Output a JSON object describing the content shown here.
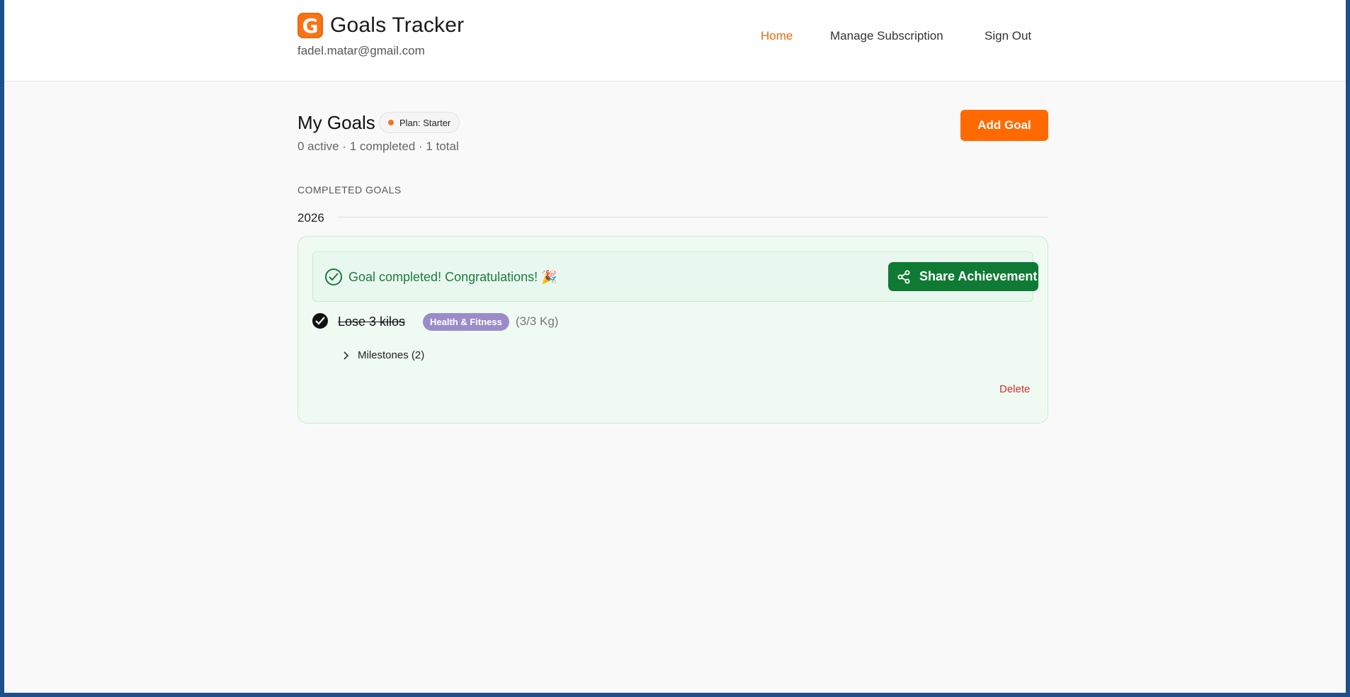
{
  "header": {
    "logo_letter": "G",
    "app_title": "Goals Tracker",
    "email": "fadel.matar@gmail.com",
    "nav": [
      {
        "label": "Home",
        "active": true
      },
      {
        "label": "Manage Subscription"
      },
      {
        "label": "Sign Out"
      }
    ]
  },
  "main": {
    "title": "My Goals",
    "plan_badge": "Plan: Starter",
    "summary": "0 active · 1 completed · 1 total",
    "add_goal_label": "Add Goal",
    "section_label": "COMPLETED GOALS",
    "year": "2026"
  },
  "goal_card": {
    "congrats_text": "Goal completed! Congratulations! 🎉",
    "share_label": "Share Achievement",
    "goal_title": "Lose 3 kilos",
    "category": "Health & Fitness",
    "progress": "(3/3 Kg)",
    "milestones_label": "Milestones (2)",
    "delete_label": "Delete"
  },
  "colors": {
    "accent": "#ff6a00",
    "success": "#0f7a33",
    "category_badge": "#9b8cc9",
    "danger": "#d92d2d"
  },
  "icons": {
    "check_circle": "check-circle-icon",
    "share": "share-icon",
    "goal_done": "check-icon",
    "expand": "chevron-right-icon"
  }
}
